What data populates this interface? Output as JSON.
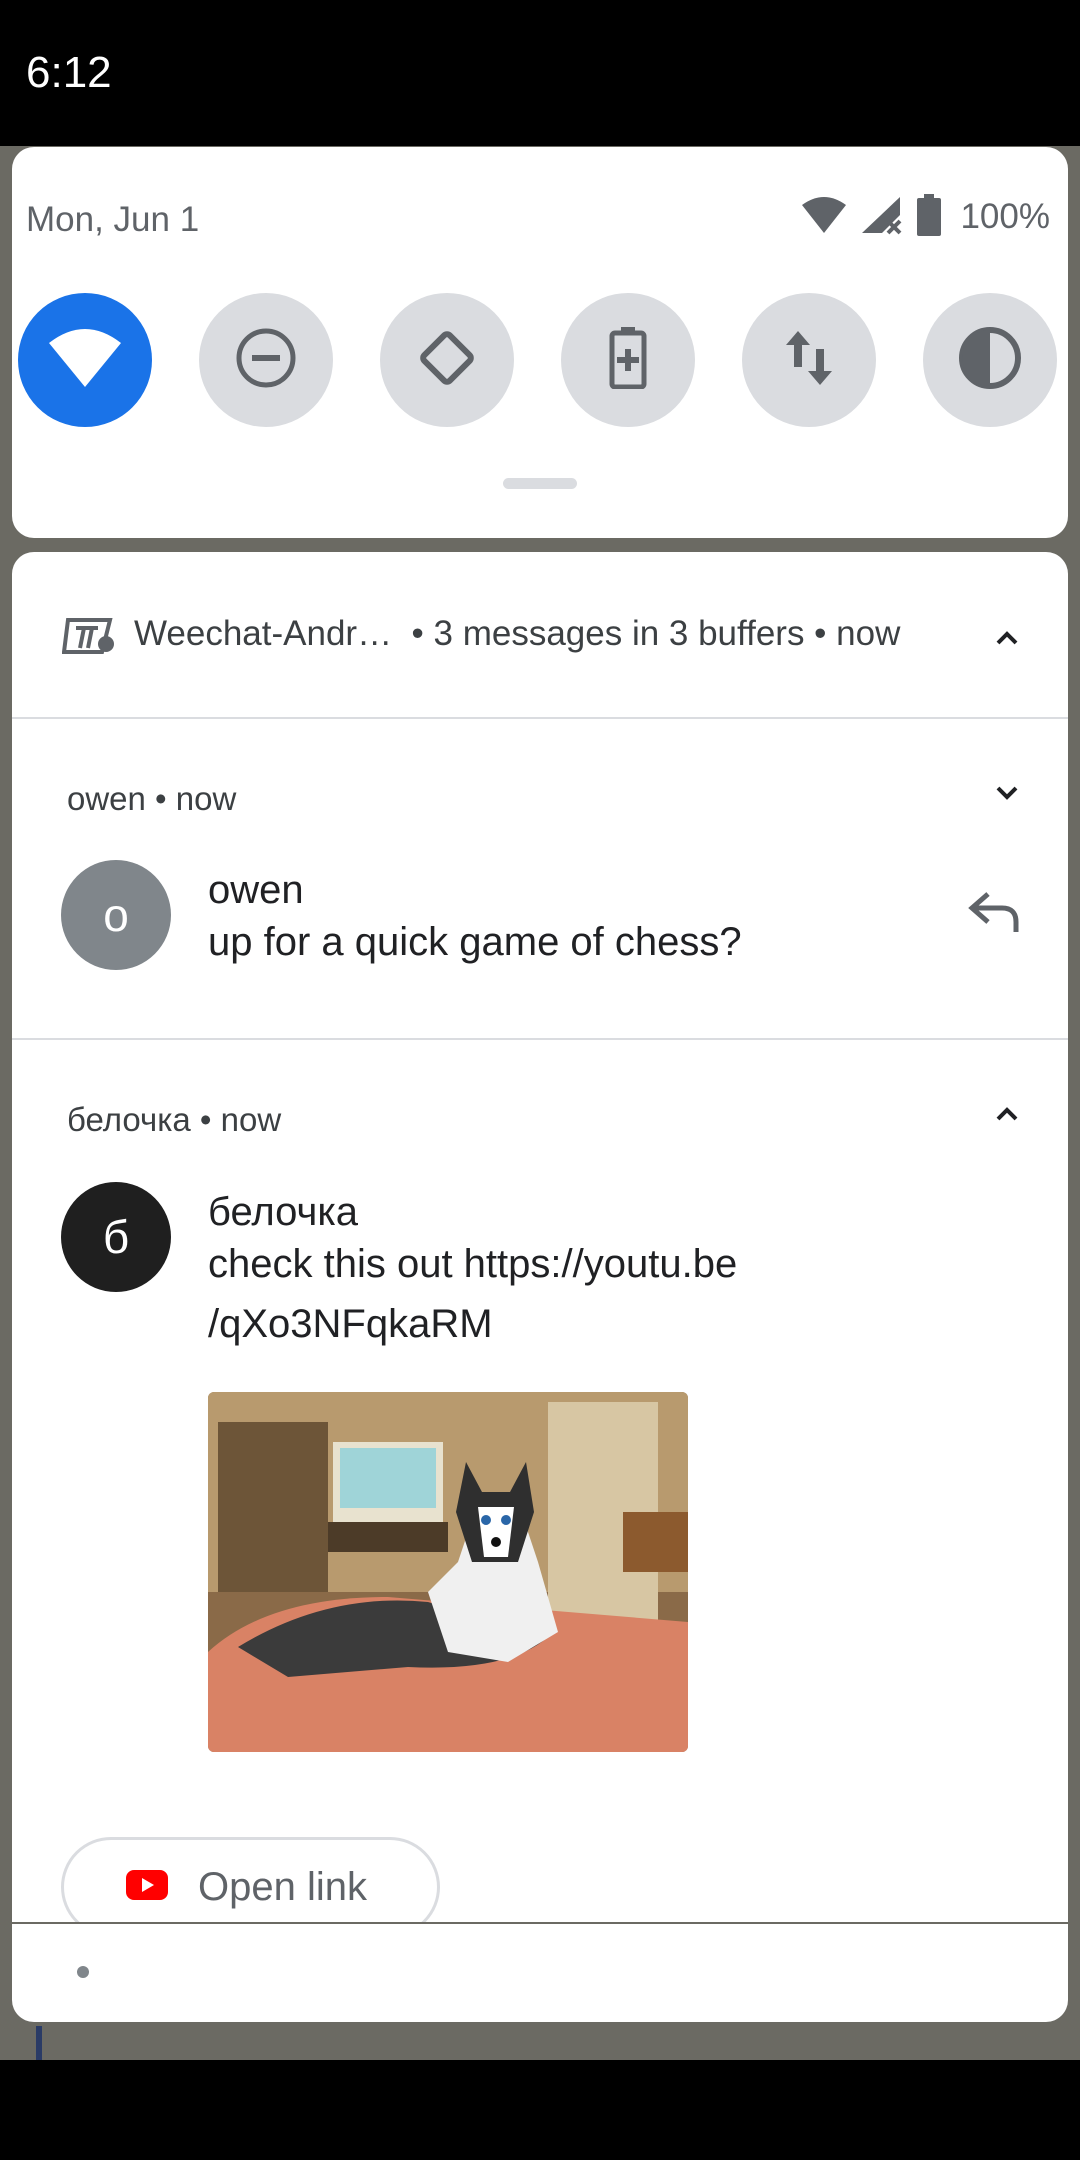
{
  "status_bar": {
    "time": "6:12"
  },
  "quick_settings": {
    "date": "Mon, Jun 1",
    "battery_percent": "100%",
    "tiles": [
      {
        "name": "wifi",
        "active": true
      },
      {
        "name": "do-not-disturb",
        "active": false
      },
      {
        "name": "auto-rotate",
        "active": false
      },
      {
        "name": "battery-saver",
        "active": false
      },
      {
        "name": "mobile-data",
        "active": false
      },
      {
        "name": "dark-theme",
        "active": false
      }
    ]
  },
  "notification": {
    "app_name": "Weechat-Andr…",
    "summary": "• 3 messages in 3 buffers • now",
    "groups": [
      {
        "header": "owen • now",
        "avatar_letter": "o",
        "sender": "owen",
        "message": "up for a quick game of chess?"
      },
      {
        "header": "белочка • now",
        "avatar_letter": "б",
        "sender": "белочка",
        "message_line1": "check this out https://youtu.be",
        "message_line2": "/qXo3NFqkaRM",
        "action_label": "Open link"
      }
    ]
  },
  "colors": {
    "accent": "#1a73e8",
    "tile_inactive": "#dadce0",
    "youtube_red": "#ff0000"
  }
}
